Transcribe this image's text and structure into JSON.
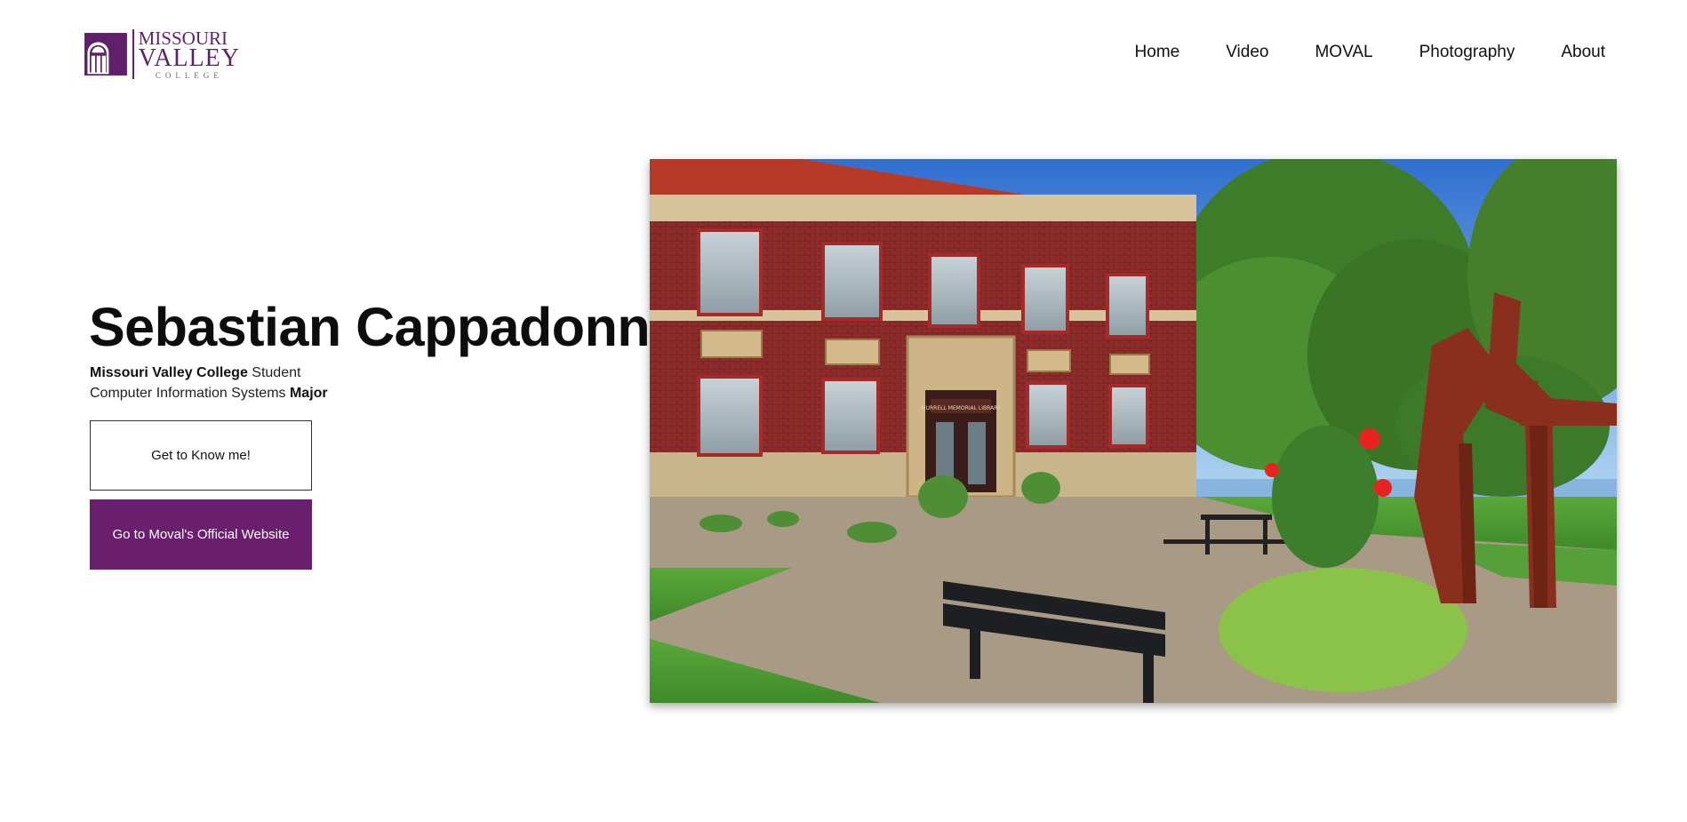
{
  "header": {
    "logo": {
      "line1": "MISSOURI",
      "line2": "VALLEY",
      "line3": "COLLEGE"
    },
    "nav": [
      {
        "label": "Home"
      },
      {
        "label": "Video"
      },
      {
        "label": "MOVAL"
      },
      {
        "label": "Photography"
      },
      {
        "label": "About"
      }
    ]
  },
  "hero": {
    "title": "Sebastian Cappadonna",
    "line1_bold": "Missouri Valley College",
    "line1_rest": " Student",
    "line2_rest": "Computer Information Systems ",
    "line2_bold": "Major",
    "button_primary": "Get to Know me!",
    "button_secondary": "Go to Moval's Official Website",
    "image_sign": "MURRELL MEMORIAL LIBRARY"
  },
  "colors": {
    "brand_purple": "#6a1f6e",
    "logo_purple": "#5f1f6b"
  },
  "icons": {
    "logo_mark": "arched-window-icon"
  }
}
